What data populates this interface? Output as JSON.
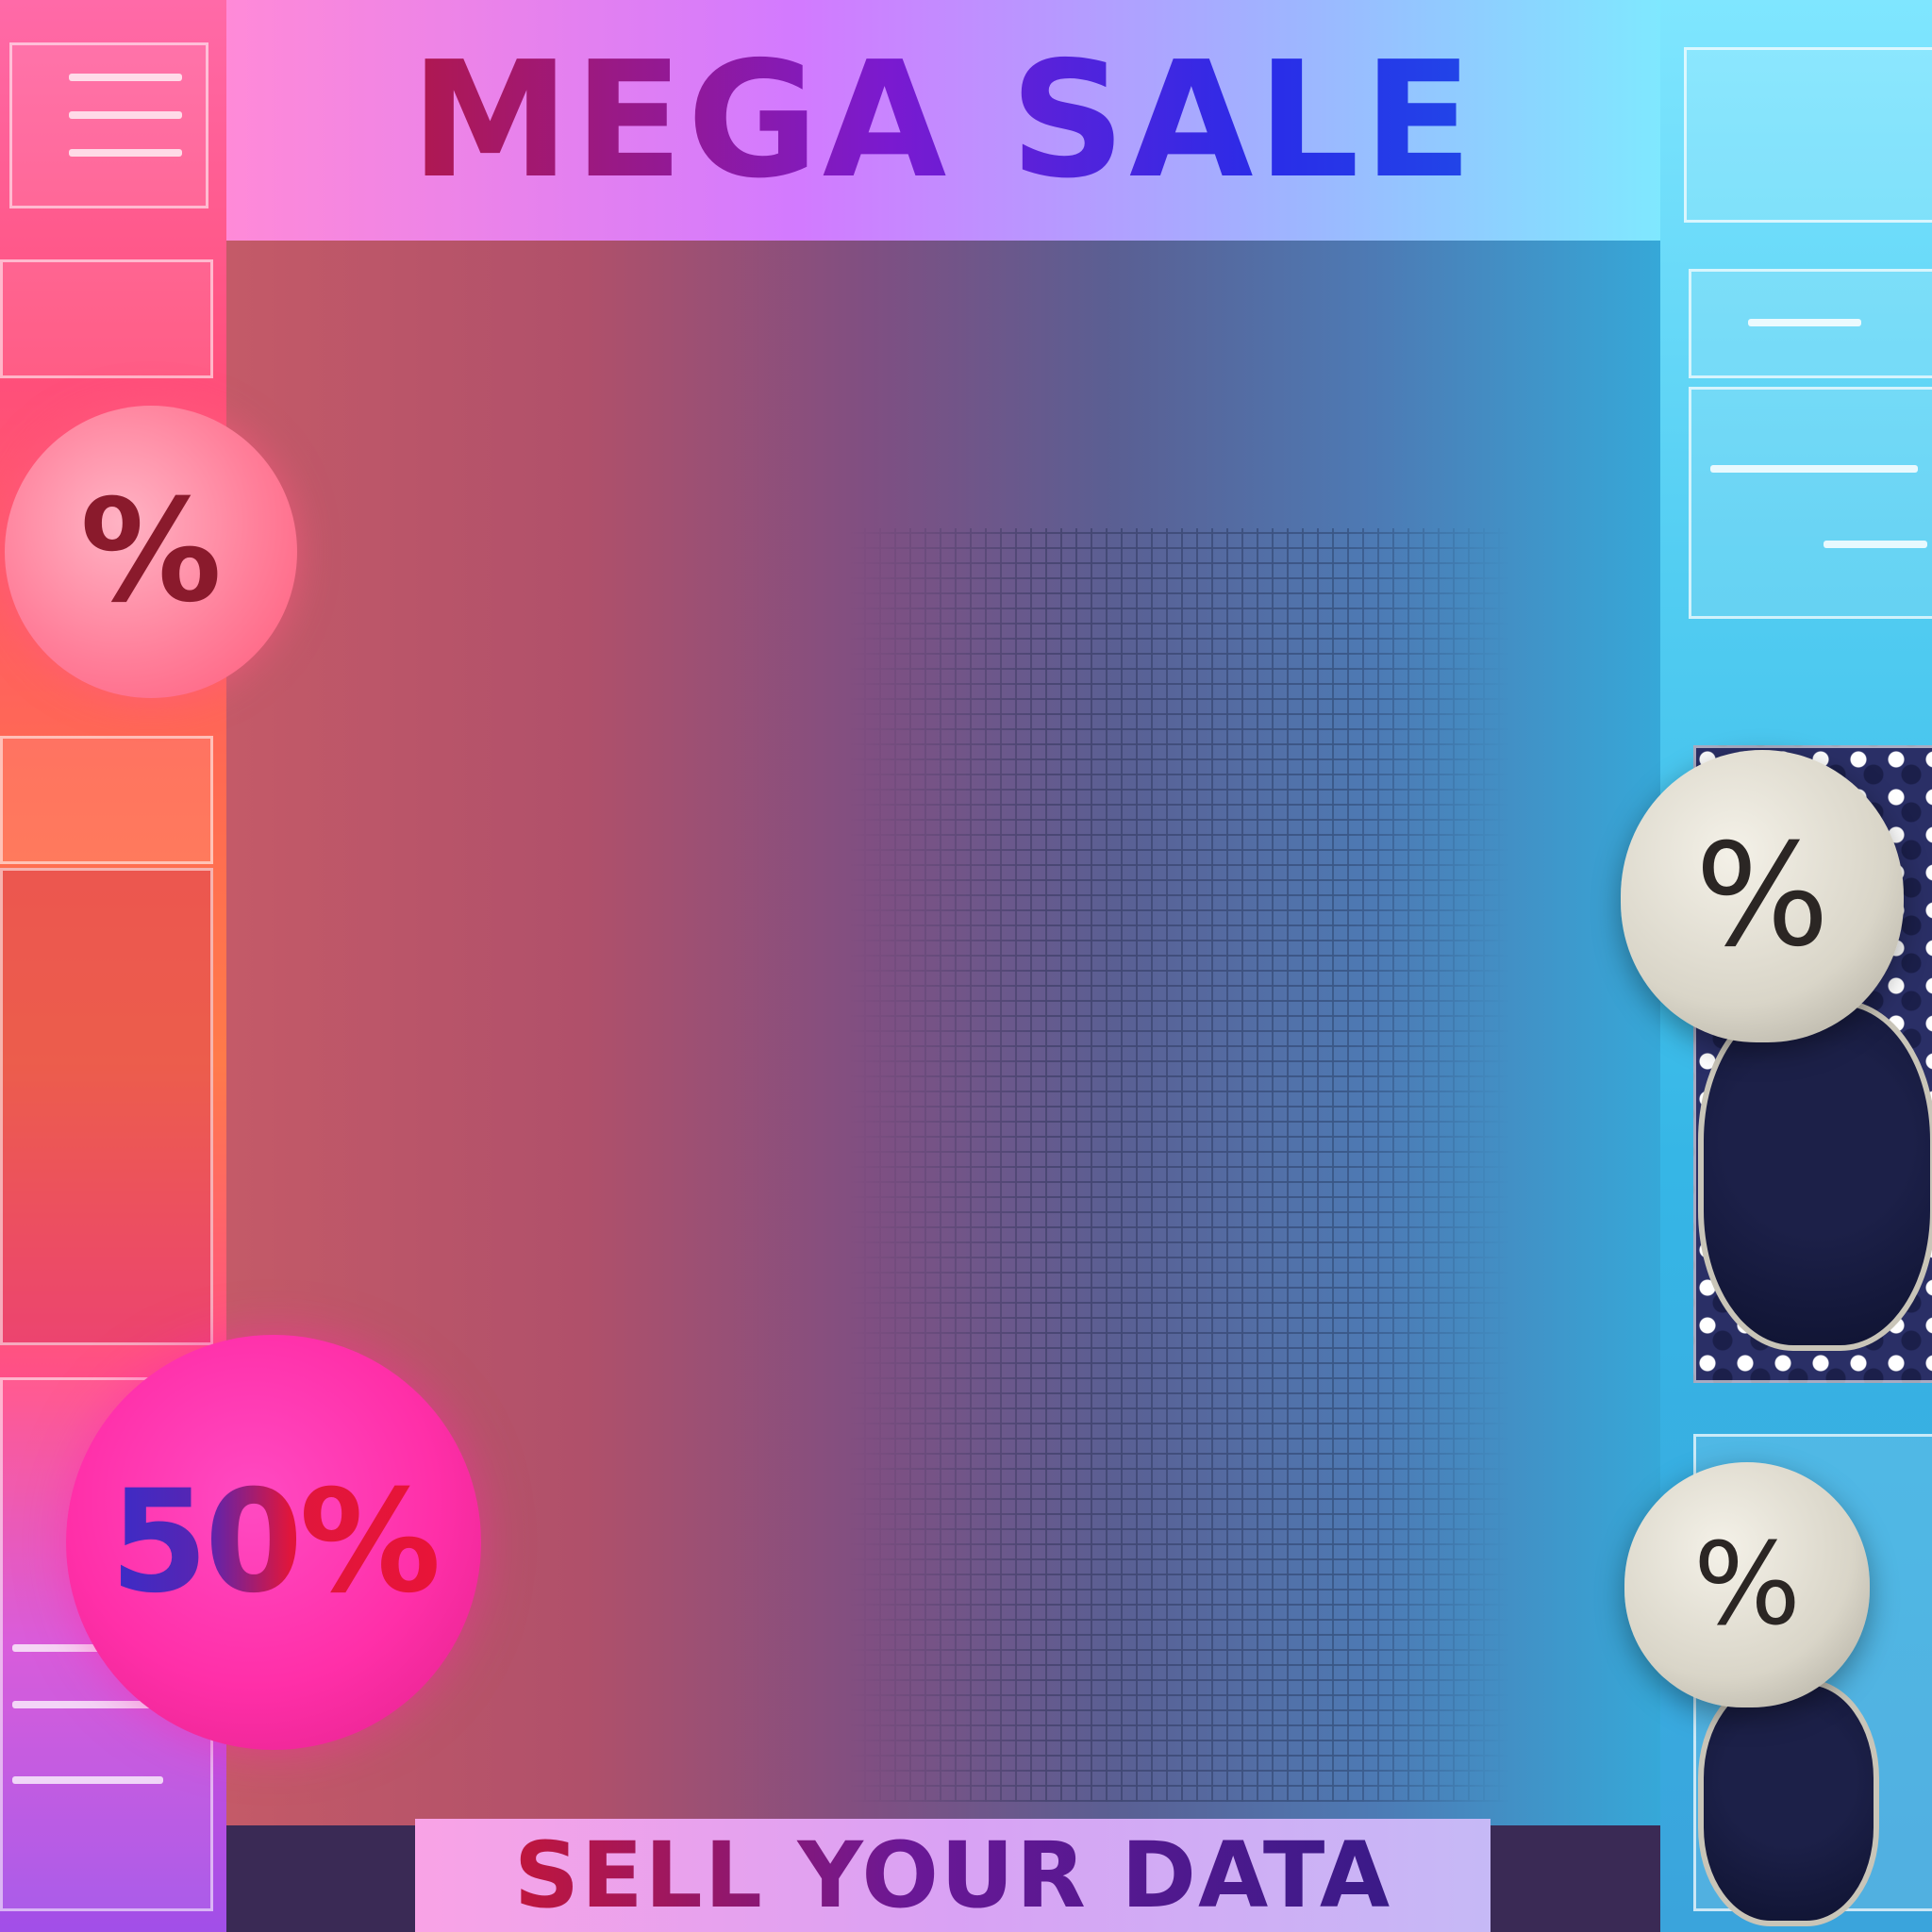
{
  "banner": {
    "headline": "MEGA SALE",
    "subline": "SELL YOUR DATA"
  },
  "badges": {
    "top_left": "%",
    "bottom_left": "50%",
    "right_upper": "%",
    "right_lower": "%"
  },
  "colors": {
    "headline_start": "#b0184f",
    "headline_end": "#2146e8",
    "left_accent": "#ff4f7a",
    "right_accent": "#36b6e6",
    "badge_magenta": "#ff2fa8"
  }
}
